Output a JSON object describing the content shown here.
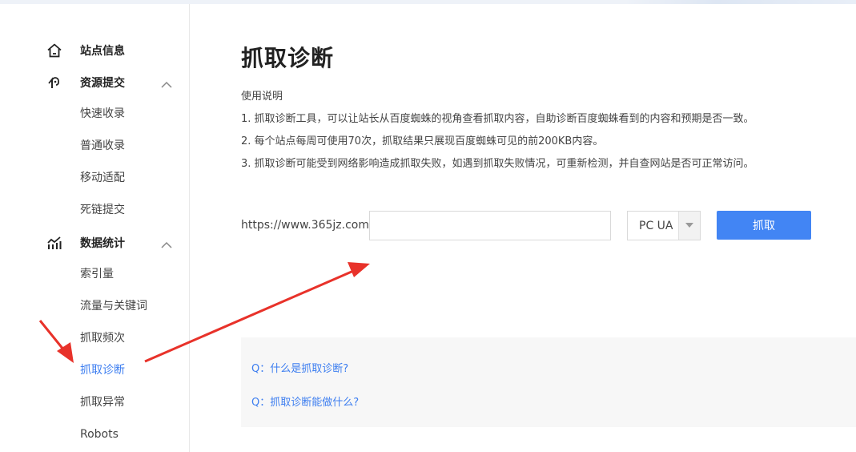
{
  "sidebar": {
    "groups": [
      {
        "label": "站点信息",
        "icon": "home-icon",
        "expanded": false
      },
      {
        "label": "资源提交",
        "icon": "resource-submit-icon",
        "expanded": true,
        "items": [
          "快速收录",
          "普通收录",
          "移动适配",
          "死链提交"
        ]
      },
      {
        "label": "数据统计",
        "icon": "chart-icon",
        "expanded": true,
        "items": [
          "索引量",
          "流量与关键词",
          "抓取频次",
          "抓取诊断",
          "抓取异常",
          "Robots"
        ]
      }
    ],
    "active_item": "抓取诊断"
  },
  "main": {
    "title": "抓取诊断",
    "instructions": [
      "使用说明",
      "1. 抓取诊断工具，可以让站长从百度蜘蛛的视角查看抓取内容，自助诊断百度蜘蛛看到的内容和预期是否一致。",
      "2. 每个站点每周可使用70次，抓取结果只展现百度蜘蛛可见的前200KB内容。",
      "3. 抓取诊断可能受到网络影响造成抓取失败，如遇到抓取失败情况，可重新检测，并自查网站是否可正常访问。"
    ],
    "url_prefix": "https://www.365jz.com/",
    "url_input": {
      "value": "",
      "placeholder": ""
    },
    "ua_select": {
      "selected": "PC UA"
    },
    "fetch_button": "抓取",
    "faq": [
      "Q：什么是抓取诊断?",
      "Q：抓取诊断能做什么?"
    ]
  },
  "colors": {
    "accent": "#4285f4",
    "link": "#3d7ef0",
    "annotation_arrow": "#e8322a"
  }
}
